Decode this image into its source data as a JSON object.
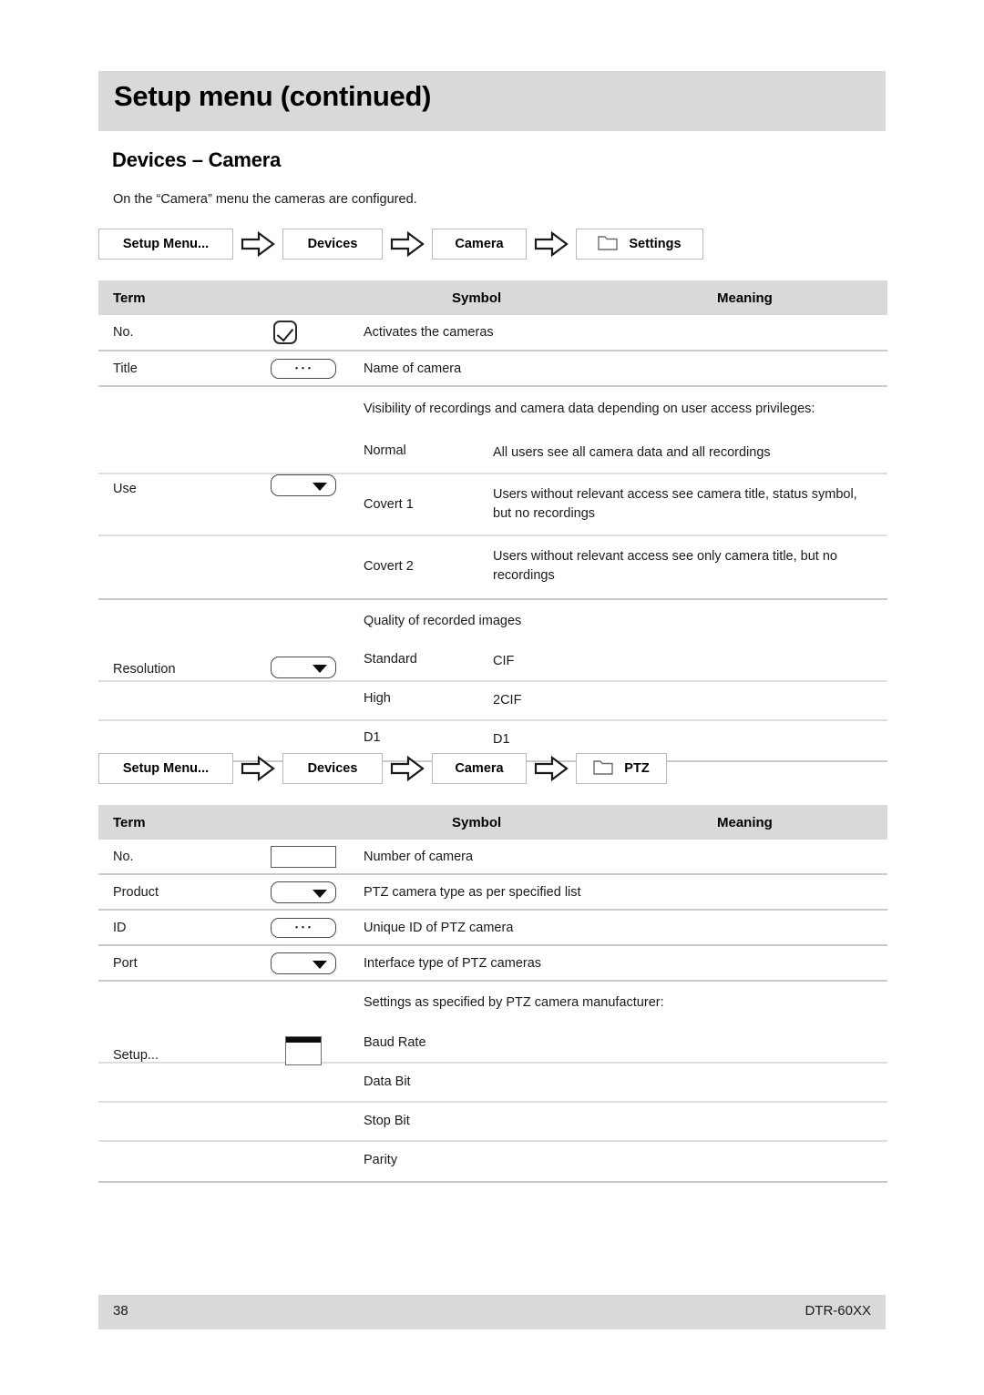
{
  "chapter": {
    "title": "Setup menu (continued)"
  },
  "section": {
    "heading": "Devices – Camera",
    "intro": "On the “Camera” menu the cameras are configured."
  },
  "breadcrumb_settings": {
    "items": [
      "Setup Menu...",
      "Devices",
      "Camera",
      "Settings"
    ],
    "folder_icon": "folder-icon",
    "arrow_icon": "arrow-right-icon"
  },
  "breadcrumb_ptz": {
    "items": [
      "Setup Menu...",
      "Devices",
      "Camera",
      "PTZ"
    ],
    "folder_icon": "folder-icon",
    "arrow_icon": "arrow-right-icon"
  },
  "table_settings": {
    "headers": [
      "Term",
      "Symbol",
      "Meaning"
    ],
    "rows": [
      {
        "term": "No.",
        "symbol": "checkbox-icon",
        "meaning": "Activates the cameras"
      },
      {
        "term": "Title",
        "symbol": "ellipsis-button-icon",
        "meaning": "Name of camera"
      },
      {
        "term": "Use",
        "symbol": "dropdown-icon",
        "meaning": "Visibility of recordings and camera data depending on user access privileges:",
        "options": [
          {
            "label": "Normal",
            "desc": "All users see all camera data and all recordings"
          },
          {
            "label": "Covert 1",
            "desc": "Users without relevant access see camera title, status symbol, but no recordings"
          },
          {
            "label": "Covert 2",
            "desc": "Users without relevant access see only camera title, but no recordings"
          }
        ]
      },
      {
        "term": "Resolution",
        "symbol": "dropdown-icon",
        "meaning": "Quality of recorded images",
        "options": [
          {
            "label": "Standard",
            "desc": "CIF"
          },
          {
            "label": "High",
            "desc": "2CIF"
          },
          {
            "label": "D1",
            "desc": "D1"
          }
        ]
      }
    ]
  },
  "table_ptz": {
    "headers": [
      "Term",
      "Symbol",
      "Meaning"
    ],
    "rows": [
      {
        "term": "No.",
        "symbol": "text-box-icon",
        "meaning": "Number of camera"
      },
      {
        "term": "Product",
        "symbol": "dropdown-icon",
        "meaning": "PTZ camera type as per specified list"
      },
      {
        "term": "ID",
        "symbol": "ellipsis-button-icon",
        "meaning": "Unique ID of PTZ camera"
      },
      {
        "term": "Port",
        "symbol": "dropdown-icon",
        "meaning": "Interface type of PTZ cameras"
      },
      {
        "term": "Setup...",
        "symbol": "window-button-icon",
        "meaning": "Settings as specified by PTZ camera manufacturer:",
        "options": [
          {
            "label": "Baud Rate",
            "desc": ""
          },
          {
            "label": "Data Bit",
            "desc": ""
          },
          {
            "label": "Stop Bit",
            "desc": ""
          },
          {
            "label": "Parity",
            "desc": ""
          }
        ]
      }
    ]
  },
  "footer": {
    "page": "38",
    "model": "DTR-60XX"
  },
  "colors": {
    "band": "#d8d9da",
    "rule": "#c9cacb",
    "text": "#1a1a1a"
  }
}
